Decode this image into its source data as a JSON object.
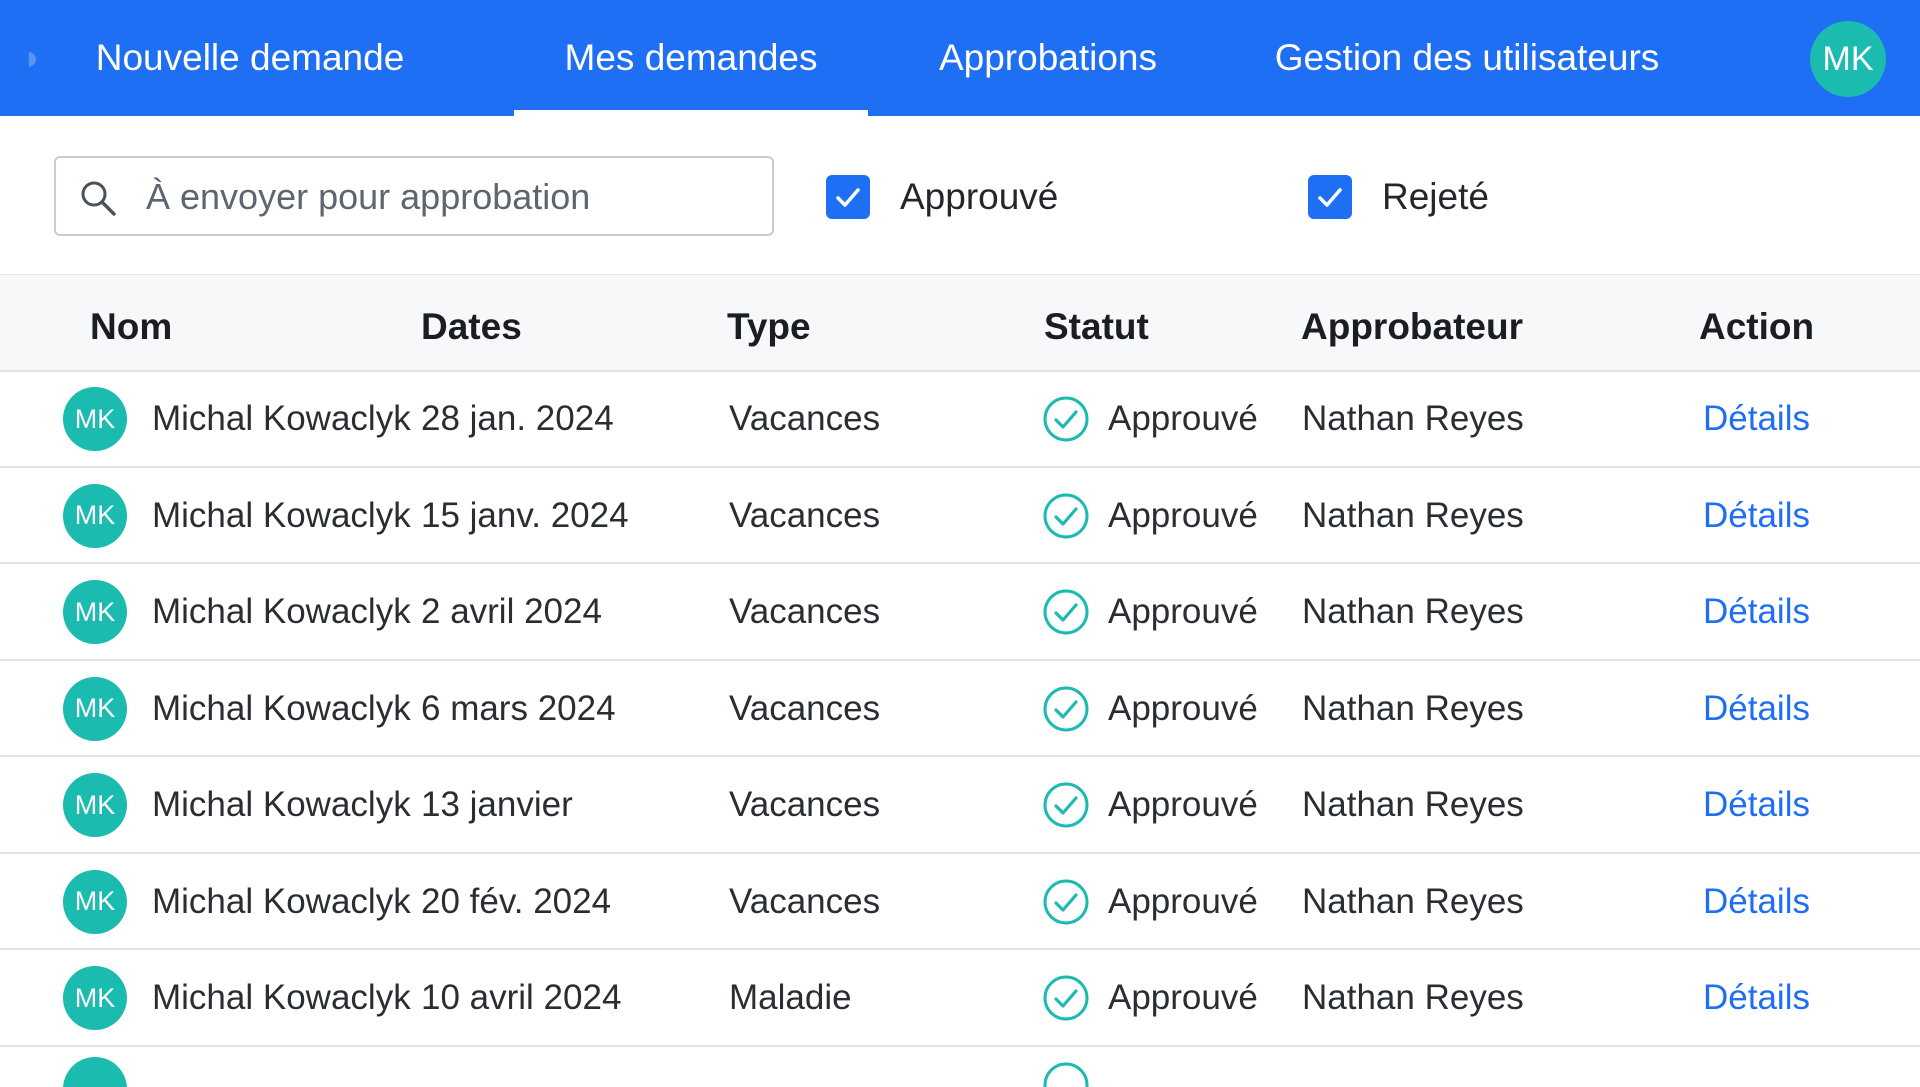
{
  "nav": {
    "tabs": [
      {
        "label": "Nouvelle  demande"
      },
      {
        "label": "Mes demandes"
      },
      {
        "label": "Approbations"
      },
      {
        "label": "Gestion des utilisateurs"
      }
    ],
    "active_tab": "Mes demandes",
    "user_initials": "MK"
  },
  "filters": {
    "search_placeholder": "À envoyer pour approbation",
    "checkboxes": [
      {
        "label": "Approuvé",
        "checked": true
      },
      {
        "label": "Rejeté",
        "checked": true
      }
    ]
  },
  "table": {
    "columns": [
      "Nom",
      "Dates",
      "Type",
      "Statut",
      "Approbateur",
      "Action"
    ],
    "rows": [
      {
        "initials": "MK",
        "name": "Michal Kowaclyk",
        "date": "28 jan. 2024",
        "type": "Vacances",
        "status": "Approuvé",
        "approver": "Nathan Reyes",
        "action": "Détails"
      },
      {
        "initials": "MK",
        "name": "Michal Kowaclyk",
        "date": "15 janv. 2024",
        "type": "Vacances",
        "status": "Approuvé",
        "approver": "Nathan Reyes",
        "action": "Détails"
      },
      {
        "initials": "MK",
        "name": "Michal Kowaclyk",
        "date": "2 avril 2024",
        "type": "Vacances",
        "status": "Approuvé",
        "approver": "Nathan Reyes",
        "action": "Détails"
      },
      {
        "initials": "MK",
        "name": "Michal Kowaclyk",
        "date": "6 mars 2024",
        "type": "Vacances",
        "status": "Approuvé",
        "approver": "Nathan Reyes",
        "action": "Détails"
      },
      {
        "initials": "MK",
        "name": "Michal Kowaclyk",
        "date": "13 janvier",
        "type": "Vacances",
        "status": "Approuvé",
        "approver": "Nathan Reyes",
        "action": "Détails"
      },
      {
        "initials": "MK",
        "name": "Michal Kowaclyk",
        "date": "20 fév. 2024",
        "type": "Vacances",
        "status": "Approuvé",
        "approver": "Nathan Reyes",
        "action": "Détails"
      },
      {
        "initials": "MK",
        "name": "Michal Kowaclyk",
        "date": "10 avril 2024",
        "type": "Maladie",
        "status": "Approuvé",
        "approver": "Nathan Reyes",
        "action": "Détails"
      }
    ]
  },
  "colors": {
    "primary": "#1e6ff4",
    "avatar": "#1bbbb0",
    "status_ok": "#1bbbb0"
  },
  "icons": {
    "search": "search-icon",
    "checkbox": "checkmark-icon",
    "status": "check-circle-icon"
  }
}
